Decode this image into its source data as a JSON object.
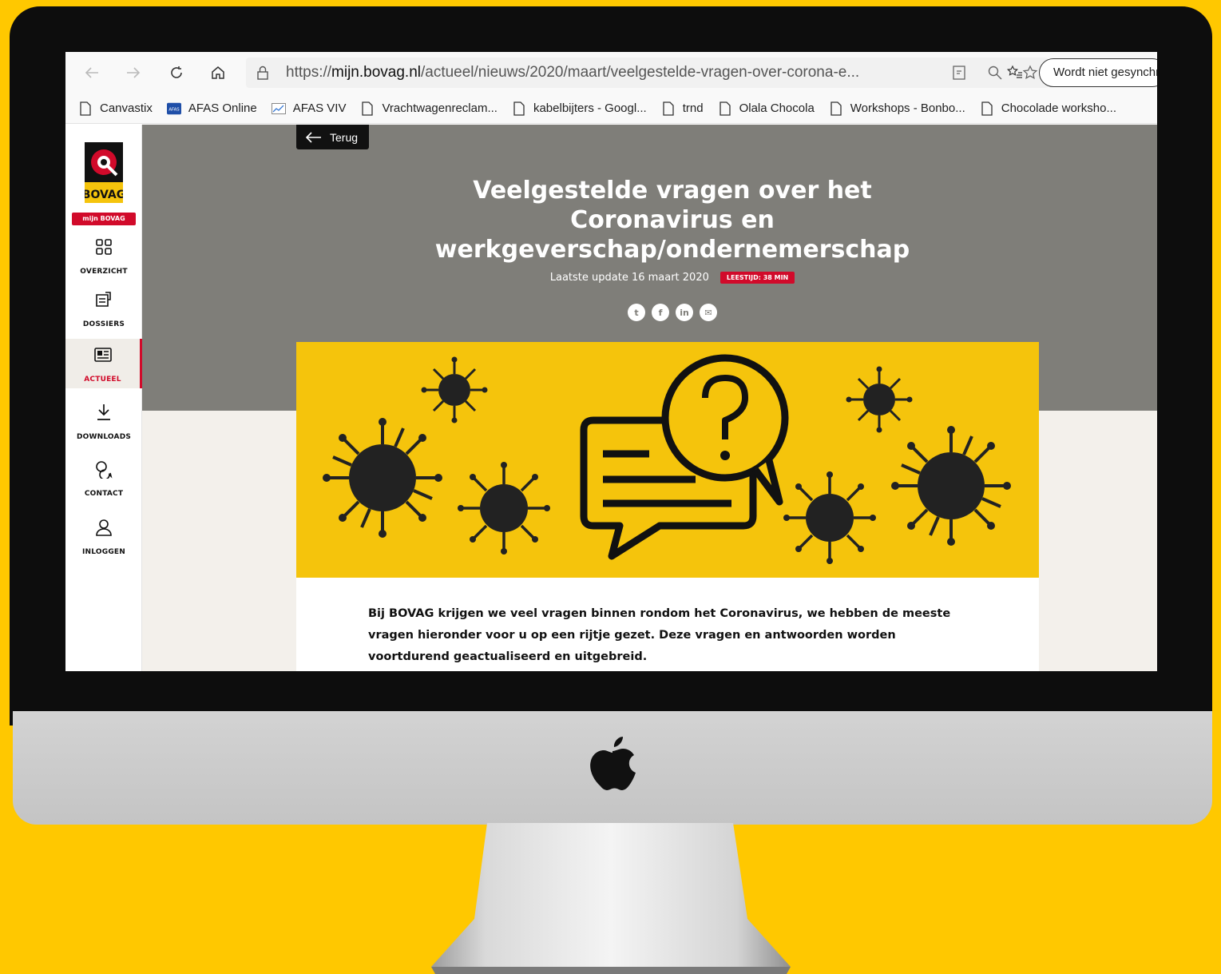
{
  "browser": {
    "url_prefix": "https://",
    "url_host": "mijn.bovag.nl",
    "url_path": "/actueel/nieuws/2020/maart/veelgestelde-vragen-over-corona-e...",
    "sync_label": "Wordt niet gesynchr",
    "bookmarks": [
      {
        "label": "Canvastix",
        "icon": "page-icon"
      },
      {
        "label": "AFAS Online",
        "icon": "afas-icon"
      },
      {
        "label": "AFAS VIV",
        "icon": "chart-icon"
      },
      {
        "label": "Vrachtwagenreclam...",
        "icon": "page-icon"
      },
      {
        "label": "kabelbijters - Googl...",
        "icon": "page-icon"
      },
      {
        "label": "trnd",
        "icon": "page-icon"
      },
      {
        "label": "Olala Chocola",
        "icon": "page-icon"
      },
      {
        "label": "Workshops - Bonbo...",
        "icon": "page-icon"
      },
      {
        "label": "Chocolade worksho...",
        "icon": "page-icon"
      }
    ]
  },
  "sidebar": {
    "logo_text": "BOVAG",
    "badge": "mijn BOVAG",
    "items": [
      {
        "label": "OVERZICHT",
        "icon": "grid-icon",
        "active": false
      },
      {
        "label": "DOSSIERS",
        "icon": "dossier-icon",
        "active": false
      },
      {
        "label": "ACTUEEL",
        "icon": "news-icon",
        "active": true
      },
      {
        "label": "DOWNLOADS",
        "icon": "download-icon",
        "active": false
      },
      {
        "label": "CONTACT",
        "icon": "chat-icon",
        "active": false
      },
      {
        "label": "INLOGGEN",
        "icon": "user-icon",
        "active": false
      }
    ]
  },
  "article": {
    "back_label": "Terug",
    "title": "Veelgestelde vragen over het Coronavirus en werkgeverschap/ondernemerschap",
    "updated": "Laatste update 16 maart 2020",
    "read_time": "LEESTIJD: 38 MIN",
    "share": [
      "twitter-icon",
      "facebook-icon",
      "linkedin-icon",
      "mail-icon"
    ],
    "intro": "Bij BOVAG krijgen we veel vragen binnen rondom het Coronavirus, we hebben de meeste vragen hieronder voor u op een rijtje gezet. Deze vragen en antwoorden worden voortdurend geactualiseerd en uitgebreid."
  },
  "colors": {
    "background": "#ffc800",
    "brand_red": "#d10a2a",
    "hero_grey": "#7f7e79",
    "banner_yellow": "#f5c40c"
  }
}
